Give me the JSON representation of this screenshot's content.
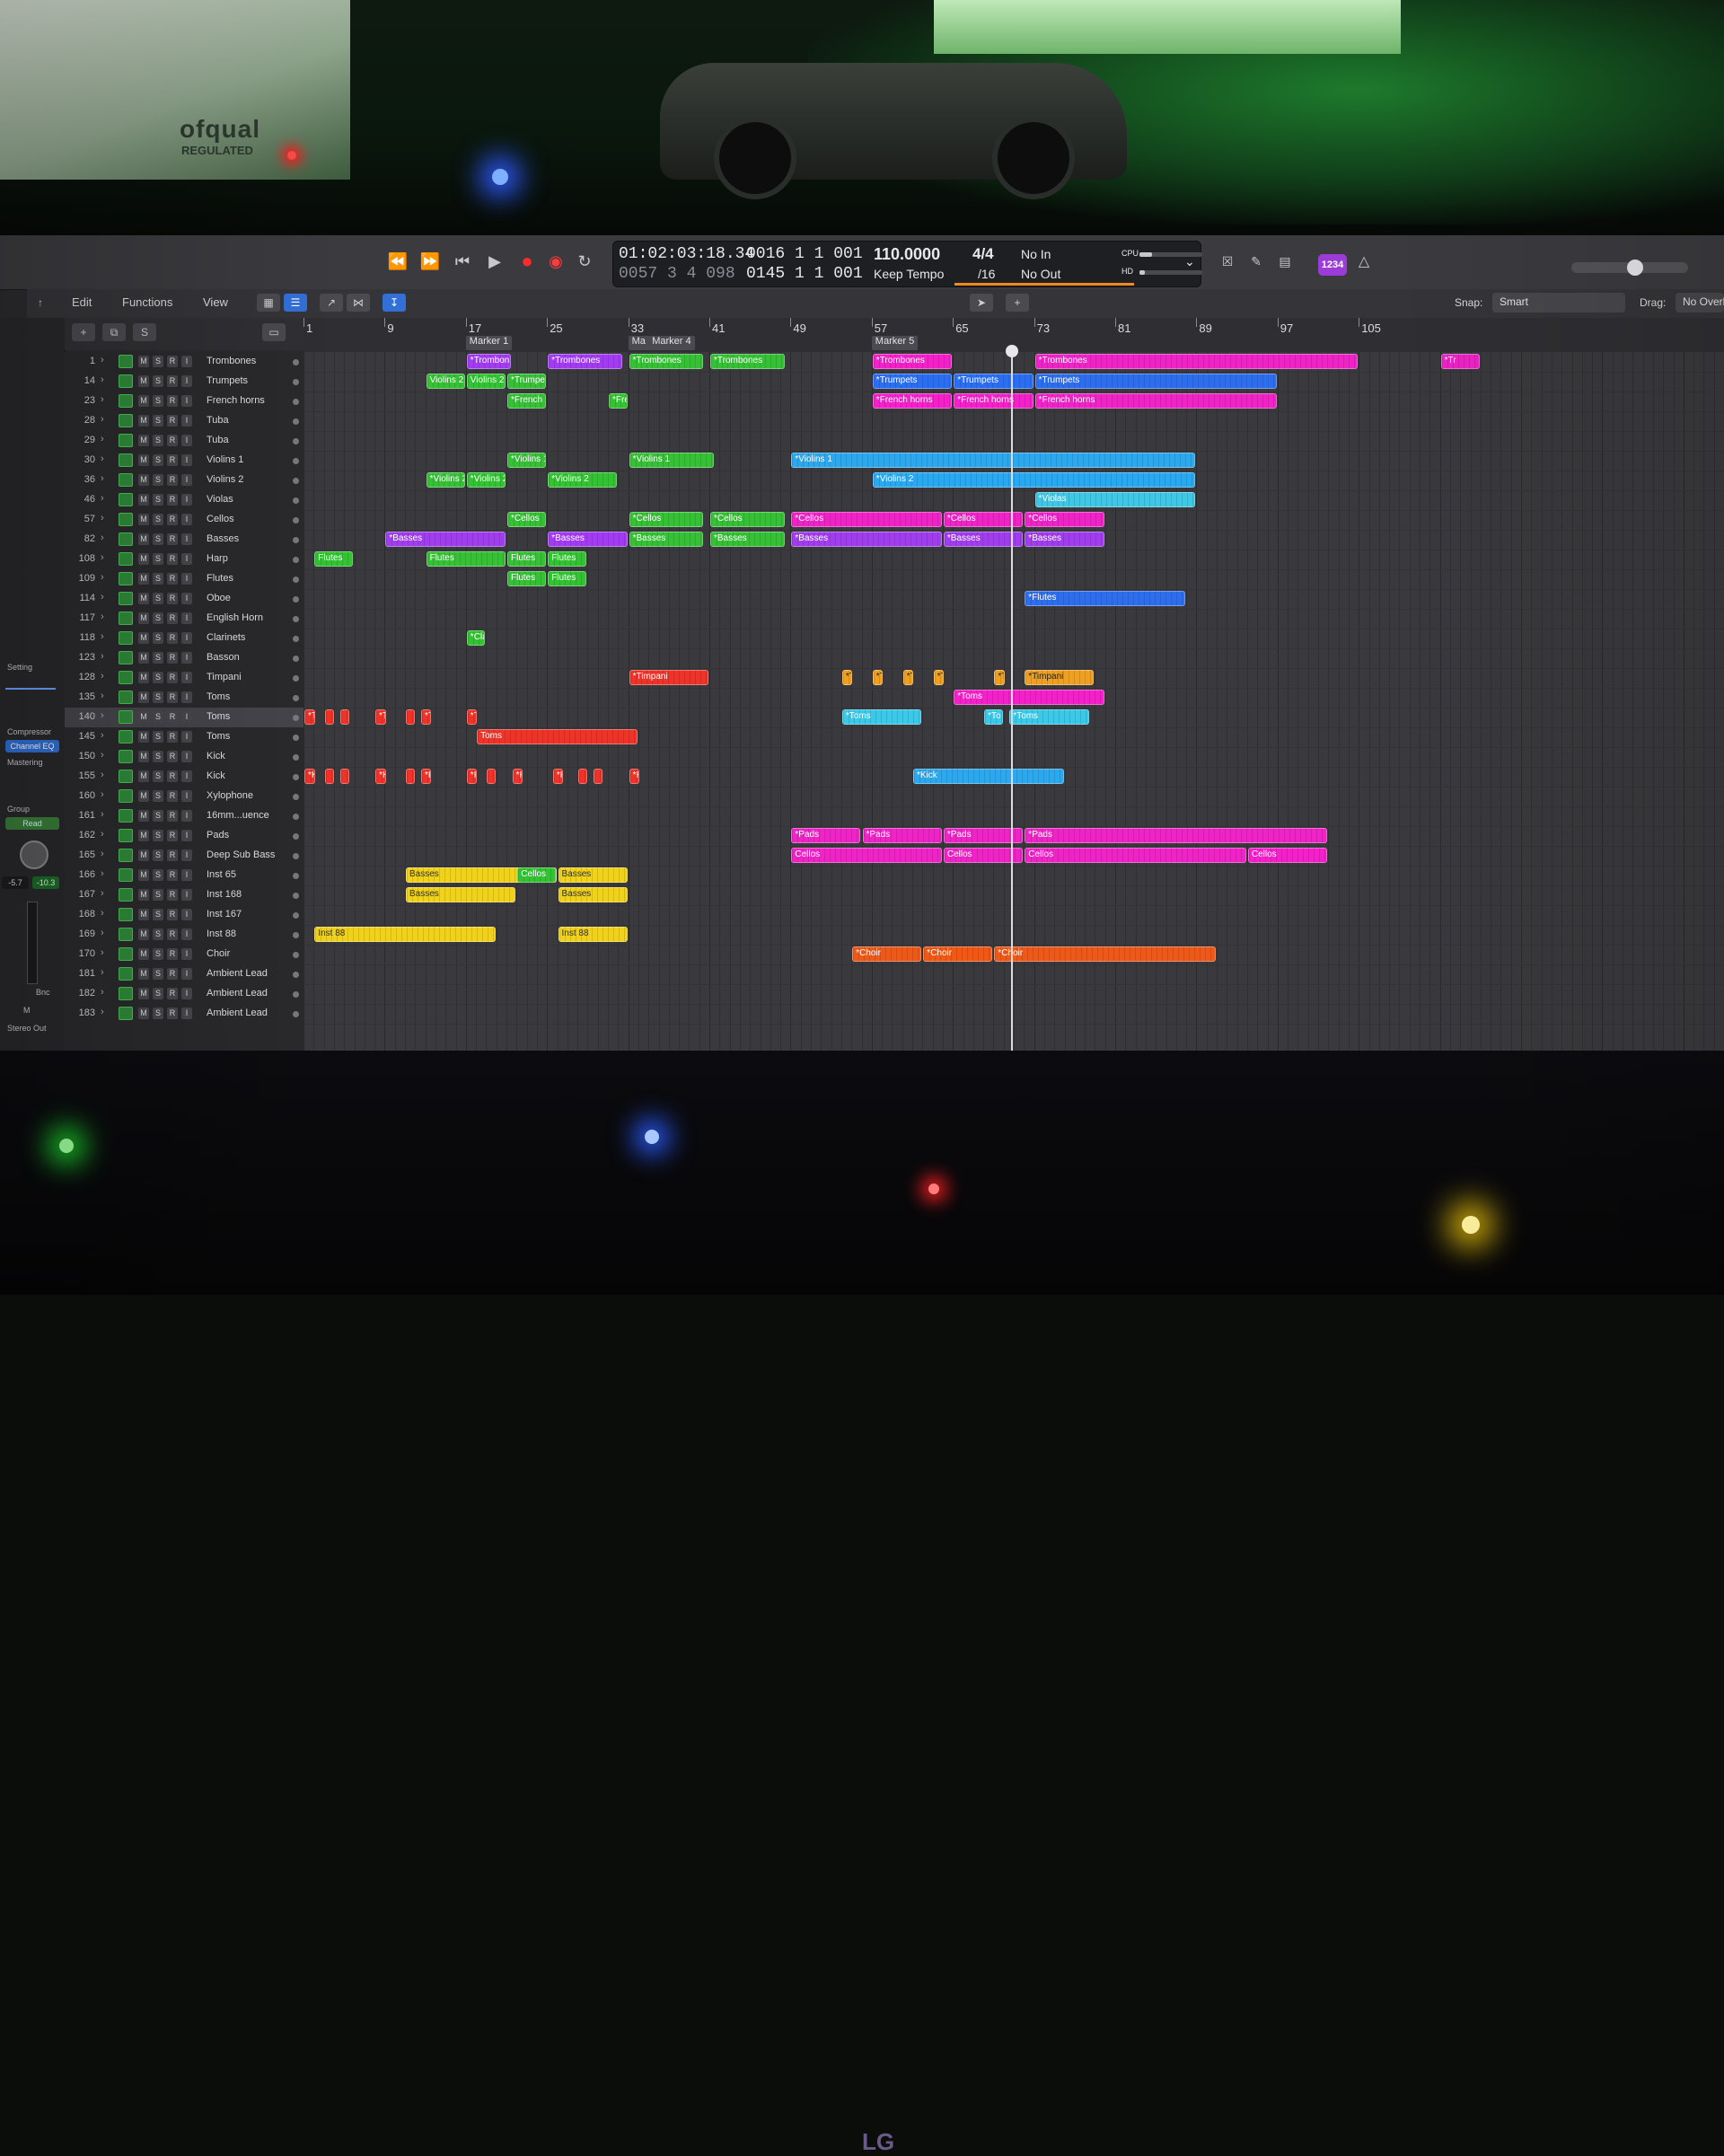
{
  "photo": {
    "certificate_left": "ofqual",
    "certificate_left_sub": "REGULATED",
    "monitor_brand": "LG"
  },
  "transport": {
    "rewind_icon": "rewind-icon",
    "forward_icon": "fast-forward-icon",
    "to_start_icon": "go-to-start-icon",
    "play_icon": "play-icon",
    "record_icon": "record-icon",
    "capture_icon": "capture-record-icon",
    "cycle_icon": "cycle-icon"
  },
  "lcd": {
    "smpte_time": "01:02:03:18.34",
    "smpte_sub": "0057 3 4 098",
    "bars_beats_top": "0016 1 1 001",
    "bars_beats_bottom": "0145 1 1 001",
    "tempo": "110.0000",
    "tempo_mode": "Keep Tempo",
    "signature": "4/4",
    "division": "/16",
    "in_label": "No In",
    "out_label": "No Out",
    "cpu_label": "CPU",
    "hd_label": "HD"
  },
  "badge": "1234",
  "toolbar": {
    "edit": "Edit",
    "functions": "Functions",
    "view": "View",
    "snap_label": "Snap:",
    "snap_value": "Smart",
    "drag_label": "Drag:",
    "drag_value": "No Overlap"
  },
  "inspector": {
    "setting": "Setting",
    "compressor": "Compressor",
    "channel_eq": "Channel EQ",
    "mastering": "Mastering",
    "group": "Group",
    "read": "Read",
    "val_left": "-5.7",
    "val_right": "-10.3",
    "bnc": "Bnc",
    "m": "M",
    "stereo_out": "Stereo Out"
  },
  "ruler": {
    "bars": [
      "1",
      "9",
      "17",
      "25",
      "33",
      "41",
      "49",
      "57",
      "65",
      "73",
      "81",
      "89",
      "97",
      "105"
    ],
    "markers": [
      "Marker 1",
      "Ma",
      "Marker 4",
      "Marker 5"
    ]
  },
  "track_buttons": [
    "M",
    "S",
    "R",
    "I"
  ],
  "tracks": [
    {
      "num": "1",
      "name": "Trombones"
    },
    {
      "num": "14",
      "name": "Trumpets"
    },
    {
      "num": "23",
      "name": "French horns"
    },
    {
      "num": "28",
      "name": "Tuba"
    },
    {
      "num": "29",
      "name": "Tuba"
    },
    {
      "num": "30",
      "name": "Violins 1"
    },
    {
      "num": "36",
      "name": "Violins 2"
    },
    {
      "num": "46",
      "name": "Violas"
    },
    {
      "num": "57",
      "name": "Cellos"
    },
    {
      "num": "82",
      "name": "Basses"
    },
    {
      "num": "108",
      "name": "Harp"
    },
    {
      "num": "109",
      "name": "Flutes"
    },
    {
      "num": "114",
      "name": "Oboe"
    },
    {
      "num": "117",
      "name": "English Horn"
    },
    {
      "num": "118",
      "name": "Clarinets"
    },
    {
      "num": "123",
      "name": "Basson"
    },
    {
      "num": "128",
      "name": "Timpani"
    },
    {
      "num": "135",
      "name": "Toms"
    },
    {
      "num": "140",
      "name": "Toms"
    },
    {
      "num": "145",
      "name": "Toms"
    },
    {
      "num": "150",
      "name": "Kick"
    },
    {
      "num": "155",
      "name": "Kick"
    },
    {
      "num": "160",
      "name": "Xylophone"
    },
    {
      "num": "161",
      "name": "16mm...uence"
    },
    {
      "num": "162",
      "name": "Pads"
    },
    {
      "num": "165",
      "name": "Deep Sub Bass"
    },
    {
      "num": "166",
      "name": "Inst 65"
    },
    {
      "num": "167",
      "name": "Inst 168"
    },
    {
      "num": "168",
      "name": "Inst 167"
    },
    {
      "num": "169",
      "name": "Inst 88"
    },
    {
      "num": "170",
      "name": "Choir"
    },
    {
      "num": "181",
      "name": "Ambient Lead"
    },
    {
      "num": "182",
      "name": "Ambient Lead"
    },
    {
      "num": "183",
      "name": "Ambient Lead"
    }
  ],
  "regions": [
    {
      "row": 0,
      "bar": 17,
      "len": 4.5,
      "c": "p",
      "label": "*Trombon"
    },
    {
      "row": 0,
      "bar": 25,
      "len": 7.5,
      "c": "p",
      "label": "*Trombones"
    },
    {
      "row": 0,
      "bar": 33,
      "len": 7.5,
      "c": "g",
      "label": "*Trombones"
    },
    {
      "row": 0,
      "bar": 41,
      "len": 7.5,
      "c": "g",
      "label": "*Trombones"
    },
    {
      "row": 0,
      "bar": 57,
      "len": 8,
      "c": "m",
      "label": "*Trombones"
    },
    {
      "row": 0,
      "bar": 73,
      "len": 32,
      "c": "m",
      "label": "*Trombones"
    },
    {
      "row": 0,
      "bar": 113,
      "len": 4,
      "c": "m",
      "label": "*Tr"
    },
    {
      "row": 1,
      "bar": 13,
      "len": 4,
      "c": "g",
      "label": "Violins 2"
    },
    {
      "row": 1,
      "bar": 17,
      "len": 4,
      "c": "g",
      "label": "Violins 2"
    },
    {
      "row": 1,
      "bar": 21,
      "len": 4,
      "c": "g",
      "label": "*Trumpet"
    },
    {
      "row": 1,
      "bar": 57,
      "len": 8,
      "c": "db",
      "label": "*Trumpets"
    },
    {
      "row": 1,
      "bar": 65,
      "len": 8,
      "c": "db",
      "label": "*Trumpets"
    },
    {
      "row": 1,
      "bar": 73,
      "len": 24,
      "c": "db",
      "label": "*Trumpets"
    },
    {
      "row": 2,
      "bar": 21,
      "len": 4,
      "c": "g",
      "label": "*French h"
    },
    {
      "row": 2,
      "bar": 31,
      "len": 2,
      "c": "g",
      "label": "*Fre"
    },
    {
      "row": 2,
      "bar": 57,
      "len": 8,
      "c": "m",
      "label": "*French horns"
    },
    {
      "row": 2,
      "bar": 65,
      "len": 8,
      "c": "m",
      "label": "*French horns"
    },
    {
      "row": 2,
      "bar": 73,
      "len": 24,
      "c": "m",
      "label": "*French horns"
    },
    {
      "row": 5,
      "bar": 21,
      "len": 4,
      "c": "g",
      "label": "*Violins 1"
    },
    {
      "row": 5,
      "bar": 33,
      "len": 8.5,
      "c": "g",
      "label": "*Violins 1"
    },
    {
      "row": 5,
      "bar": 49,
      "len": 40,
      "c": "b",
      "label": "*Violins 1"
    },
    {
      "row": 6,
      "bar": 13,
      "len": 4,
      "c": "g",
      "label": "*Violins 2"
    },
    {
      "row": 6,
      "bar": 17,
      "len": 4,
      "c": "g",
      "label": "*Violins 2"
    },
    {
      "row": 6,
      "bar": 25,
      "len": 7,
      "c": "g",
      "label": "*Violins 2"
    },
    {
      "row": 6,
      "bar": 57,
      "len": 32,
      "c": "b",
      "label": "*Violins 2"
    },
    {
      "row": 7,
      "bar": 73,
      "len": 16,
      "c": "c",
      "label": "*Violas"
    },
    {
      "row": 8,
      "bar": 21,
      "len": 4,
      "c": "g",
      "label": "*Cellos"
    },
    {
      "row": 8,
      "bar": 33,
      "len": 7.5,
      "c": "g",
      "label": "*Cellos"
    },
    {
      "row": 8,
      "bar": 41,
      "len": 7.5,
      "c": "g",
      "label": "*Cellos"
    },
    {
      "row": 8,
      "bar": 49,
      "len": 15,
      "c": "m",
      "label": "*Cellos"
    },
    {
      "row": 8,
      "bar": 64,
      "len": 8,
      "c": "m",
      "label": "*Cellos"
    },
    {
      "row": 8,
      "bar": 72,
      "len": 8,
      "c": "m",
      "label": "*Cellos"
    },
    {
      "row": 9,
      "bar": 9,
      "len": 12,
      "c": "p",
      "label": "*Basses"
    },
    {
      "row": 9,
      "bar": 25,
      "len": 8,
      "c": "p",
      "label": "*Basses"
    },
    {
      "row": 9,
      "bar": 33,
      "len": 7.5,
      "c": "g",
      "label": "*Basses"
    },
    {
      "row": 9,
      "bar": 41,
      "len": 7.5,
      "c": "g",
      "label": "*Basses"
    },
    {
      "row": 9,
      "bar": 49,
      "len": 15,
      "c": "p",
      "label": "*Basses"
    },
    {
      "row": 9,
      "bar": 64,
      "len": 8,
      "c": "p",
      "label": "*Basses"
    },
    {
      "row": 9,
      "bar": 72,
      "len": 8,
      "c": "p",
      "label": "*Basses"
    },
    {
      "row": 10,
      "bar": 2,
      "len": 4,
      "c": "g",
      "label": "Flutes"
    },
    {
      "row": 10,
      "bar": 13,
      "len": 8,
      "c": "g",
      "label": "Flutes"
    },
    {
      "row": 10,
      "bar": 21,
      "len": 4,
      "c": "g",
      "label": "Flutes"
    },
    {
      "row": 10,
      "bar": 25,
      "len": 4,
      "c": "g",
      "label": "Flutes"
    },
    {
      "row": 11,
      "bar": 21,
      "len": 4,
      "c": "g",
      "label": "Flutes"
    },
    {
      "row": 11,
      "bar": 25,
      "len": 4,
      "c": "g",
      "label": "Flutes"
    },
    {
      "row": 12,
      "bar": 72,
      "len": 16,
      "c": "db",
      "label": "*Flutes"
    },
    {
      "row": 14,
      "bar": 17,
      "len": 2,
      "c": "g",
      "label": "*Cla"
    },
    {
      "row": 16,
      "bar": 33,
      "len": 8,
      "c": "r",
      "label": "*Timpani"
    },
    {
      "row": 16,
      "bar": 54,
      "len": 1.2,
      "c": "a",
      "label": "*T"
    },
    {
      "row": 16,
      "bar": 57,
      "len": 1.2,
      "c": "a",
      "label": "*T"
    },
    {
      "row": 16,
      "bar": 60,
      "len": 1.2,
      "c": "a",
      "label": "*T"
    },
    {
      "row": 16,
      "bar": 63,
      "len": 1.2,
      "c": "a",
      "label": "*T"
    },
    {
      "row": 16,
      "bar": 69,
      "len": 1.2,
      "c": "a",
      "label": "*T"
    },
    {
      "row": 16,
      "bar": 72,
      "len": 7,
      "c": "a",
      "label": "*Timpani"
    },
    {
      "row": 17,
      "bar": 65,
      "len": 15,
      "c": "m",
      "label": "*Toms"
    },
    {
      "row": 18,
      "bar": 1,
      "len": 1.2,
      "c": "r",
      "label": "*T"
    },
    {
      "row": 18,
      "bar": 3,
      "len": 1,
      "c": "r",
      "label": ""
    },
    {
      "row": 18,
      "bar": 4.5,
      "len": 1,
      "c": "r",
      "label": ""
    },
    {
      "row": 18,
      "bar": 8,
      "len": 1.2,
      "c": "r",
      "label": "*T"
    },
    {
      "row": 18,
      "bar": 11,
      "len": 1,
      "c": "r",
      "label": ""
    },
    {
      "row": 18,
      "bar": 12.5,
      "len": 1.2,
      "c": "r",
      "label": "*T"
    },
    {
      "row": 18,
      "bar": 17,
      "len": 1.2,
      "c": "r",
      "label": "*T"
    },
    {
      "row": 18,
      "bar": 54,
      "len": 8,
      "c": "c",
      "label": "*Toms"
    },
    {
      "row": 18,
      "bar": 68,
      "len": 2,
      "c": "c",
      "label": "*To"
    },
    {
      "row": 18,
      "bar": 70.5,
      "len": 8,
      "c": "c",
      "label": "*Toms"
    },
    {
      "row": 19,
      "bar": 18,
      "len": 16,
      "c": "r",
      "label": "Toms"
    },
    {
      "row": 21,
      "bar": 1,
      "len": 1.2,
      "c": "r",
      "label": "*Ki"
    },
    {
      "row": 21,
      "bar": 3,
      "len": 1,
      "c": "r",
      "label": ""
    },
    {
      "row": 21,
      "bar": 4.5,
      "len": 1,
      "c": "r",
      "label": ""
    },
    {
      "row": 21,
      "bar": 8,
      "len": 1.2,
      "c": "r",
      "label": "*Ki"
    },
    {
      "row": 21,
      "bar": 11,
      "len": 1,
      "c": "r",
      "label": ""
    },
    {
      "row": 21,
      "bar": 12.5,
      "len": 1.2,
      "c": "r",
      "label": "*Ki"
    },
    {
      "row": 21,
      "bar": 17,
      "len": 1.2,
      "c": "r",
      "label": "*Ki"
    },
    {
      "row": 21,
      "bar": 19,
      "len": 1,
      "c": "r",
      "label": ""
    },
    {
      "row": 21,
      "bar": 21.5,
      "len": 1.2,
      "c": "r",
      "label": "*Ki"
    },
    {
      "row": 21,
      "bar": 25.5,
      "len": 1.2,
      "c": "r",
      "label": "*Ki"
    },
    {
      "row": 21,
      "bar": 28,
      "len": 1,
      "c": "r",
      "label": ""
    },
    {
      "row": 21,
      "bar": 29.5,
      "len": 1,
      "c": "r",
      "label": ""
    },
    {
      "row": 21,
      "bar": 33,
      "len": 1.2,
      "c": "r",
      "label": "*Ki"
    },
    {
      "row": 21,
      "bar": 61,
      "len": 15,
      "c": "b",
      "label": "*Kick"
    },
    {
      "row": 24,
      "bar": 49,
      "len": 7,
      "c": "m",
      "label": "*Pads"
    },
    {
      "row": 24,
      "bar": 56,
      "len": 8,
      "c": "m",
      "label": "*Pads"
    },
    {
      "row": 24,
      "bar": 64,
      "len": 8,
      "c": "m",
      "label": "*Pads"
    },
    {
      "row": 24,
      "bar": 72,
      "len": 30,
      "c": "m",
      "label": "*Pads"
    },
    {
      "row": 25,
      "bar": 49,
      "len": 15,
      "c": "m",
      "label": "Cellos"
    },
    {
      "row": 25,
      "bar": 64,
      "len": 8,
      "c": "m",
      "label": "Cellos"
    },
    {
      "row": 25,
      "bar": 72,
      "len": 22,
      "c": "m",
      "label": "Cellos"
    },
    {
      "row": 25,
      "bar": 94,
      "len": 8,
      "c": "m",
      "label": "Cellos"
    },
    {
      "row": 26,
      "bar": 11,
      "len": 15,
      "c": "y",
      "label": "Basses"
    },
    {
      "row": 26,
      "bar": 22,
      "len": 4,
      "c": "g",
      "label": "Cellos"
    },
    {
      "row": 26,
      "bar": 26,
      "len": 7,
      "c": "y",
      "label": "Basses"
    },
    {
      "row": 27,
      "bar": 11,
      "len": 11,
      "c": "y",
      "label": "Basses"
    },
    {
      "row": 27,
      "bar": 26,
      "len": 7,
      "c": "y",
      "label": "Basses"
    },
    {
      "row": 29,
      "bar": 2,
      "len": 18,
      "c": "y",
      "label": "Inst 88"
    },
    {
      "row": 29,
      "bar": 26,
      "len": 7,
      "c": "y",
      "label": "Inst 88"
    },
    {
      "row": 30,
      "bar": 55,
      "len": 7,
      "c": "o",
      "label": "*Choir"
    },
    {
      "row": 30,
      "bar": 62,
      "len": 7,
      "c": "o",
      "label": "*Choir"
    },
    {
      "row": 30,
      "bar": 69,
      "len": 22,
      "c": "o",
      "label": "*Choir"
    }
  ]
}
